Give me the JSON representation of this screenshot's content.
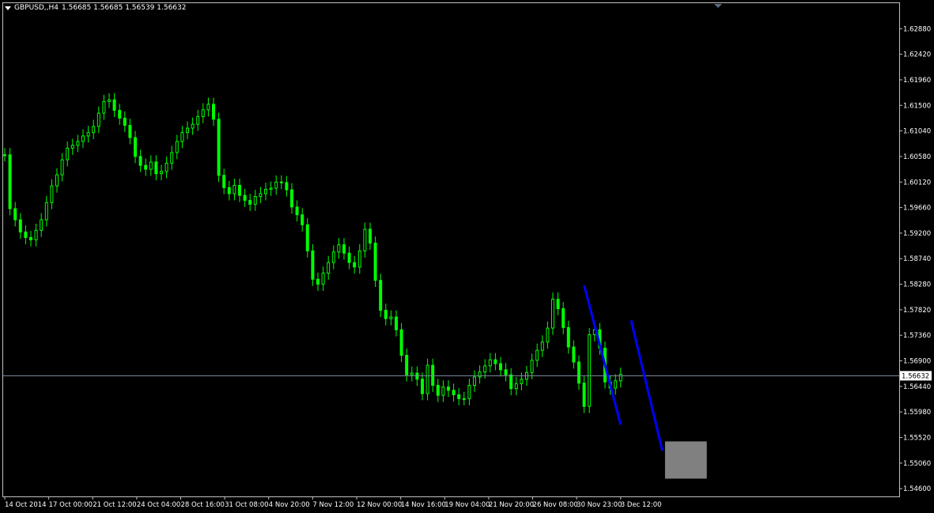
{
  "header": {
    "symbol_label": "GBPUSD,,H4",
    "ohlc_text": "1.56685 1.56685 1.56539 1.56632"
  },
  "price_tag": "1.56632",
  "colors": {
    "background": "#000000",
    "candle": "#00ff00",
    "axis_text": "#ffffff",
    "frame": "#c0c0c0",
    "price_line": "#7f8fa6",
    "trendline": "#0000ff",
    "box": "#808080",
    "price_tag_bg": "#ffffff",
    "price_tag_text": "#000000"
  },
  "chart_data": {
    "type": "candlestick",
    "symbol": "GBPUSD",
    "timeframe": "H4",
    "ylim": [
      1.5446,
      1.6334
    ],
    "y_ticks": [
      "1.62880",
      "1.62420",
      "1.61960",
      "1.61500",
      "1.61040",
      "1.60580",
      "1.60120",
      "1.59660",
      "1.59200",
      "1.58740",
      "1.58280",
      "1.57820",
      "1.57360",
      "1.56900",
      "1.56440",
      "1.55980",
      "1.55520",
      "1.55060",
      "1.54600"
    ],
    "x_tick_labels": [
      "14 Oct 2014",
      "17 Oct 00:00",
      "21 Oct 12:00",
      "24 Oct 04:00",
      "28 Oct 16:00",
      "31 Oct 08:00",
      "4 Nov 20:00",
      "7 Nov 12:00",
      "12 Nov 00:00",
      "14 Nov 16:00",
      "19 Nov 04:00",
      "21 Nov 20:00",
      "26 Nov 08:00",
      "30 Nov 23:00",
      "3 Dec 12:00"
    ],
    "current_price": 1.56632,
    "closes": [
      1.6061,
      1.5964,
      1.5944,
      1.5922,
      1.5912,
      1.5908,
      1.5925,
      1.5944,
      1.5975,
      1.6005,
      1.6025,
      1.6052,
      1.6073,
      1.6078,
      1.6085,
      1.6095,
      1.6101,
      1.6112,
      1.6136,
      1.6157,
      1.616,
      1.6141,
      1.6127,
      1.6114,
      1.6092,
      1.6058,
      1.6042,
      1.6035,
      1.6048,
      1.6027,
      1.6031,
      1.6046,
      1.6065,
      1.6085,
      1.6101,
      1.6109,
      1.6116,
      1.613,
      1.6142,
      1.6152,
      1.6125,
      1.6024,
      1.6002,
      1.5991,
      1.6006,
      1.5988,
      1.5979,
      1.5972,
      1.5986,
      1.5991,
      1.5999,
      1.6001,
      1.6012,
      1.6011,
      1.5998,
      1.5967,
      1.5953,
      1.5935,
      1.5888,
      1.5837,
      1.5828,
      1.5848,
      1.5867,
      1.5886,
      1.5899,
      1.5884,
      1.5867,
      1.5859,
      1.5888,
      1.5927,
      1.5902,
      1.5835,
      1.5781,
      1.5766,
      1.5769,
      1.5746,
      1.57,
      1.5665,
      1.5668,
      1.5657,
      1.5631,
      1.5682,
      1.5646,
      1.5628,
      1.5643,
      1.5637,
      1.5629,
      1.5622,
      1.5622,
      1.5646,
      1.5661,
      1.567,
      1.5681,
      1.5692,
      1.5685,
      1.5674,
      1.5665,
      1.564,
      1.5649,
      1.5657,
      1.5669,
      1.5691,
      1.5709,
      1.5724,
      1.5749,
      1.5801,
      1.5784,
      1.575,
      1.5715,
      1.5688,
      1.565,
      1.5608,
      1.5737,
      1.5746,
      1.5713,
      1.5652,
      1.5641,
      1.5654,
      1.5666
    ],
    "trendlines": [
      {
        "from": [
          111,
          1.5826
        ],
        "to": [
          118,
          1.5575
        ]
      },
      {
        "from": [
          120,
          1.5763
        ],
        "to": [
          126,
          1.5528
        ]
      }
    ],
    "box": {
      "x_from": 126.5,
      "x_to": 134.5,
      "y_from": 1.5545,
      "y_to": 1.5478
    }
  }
}
